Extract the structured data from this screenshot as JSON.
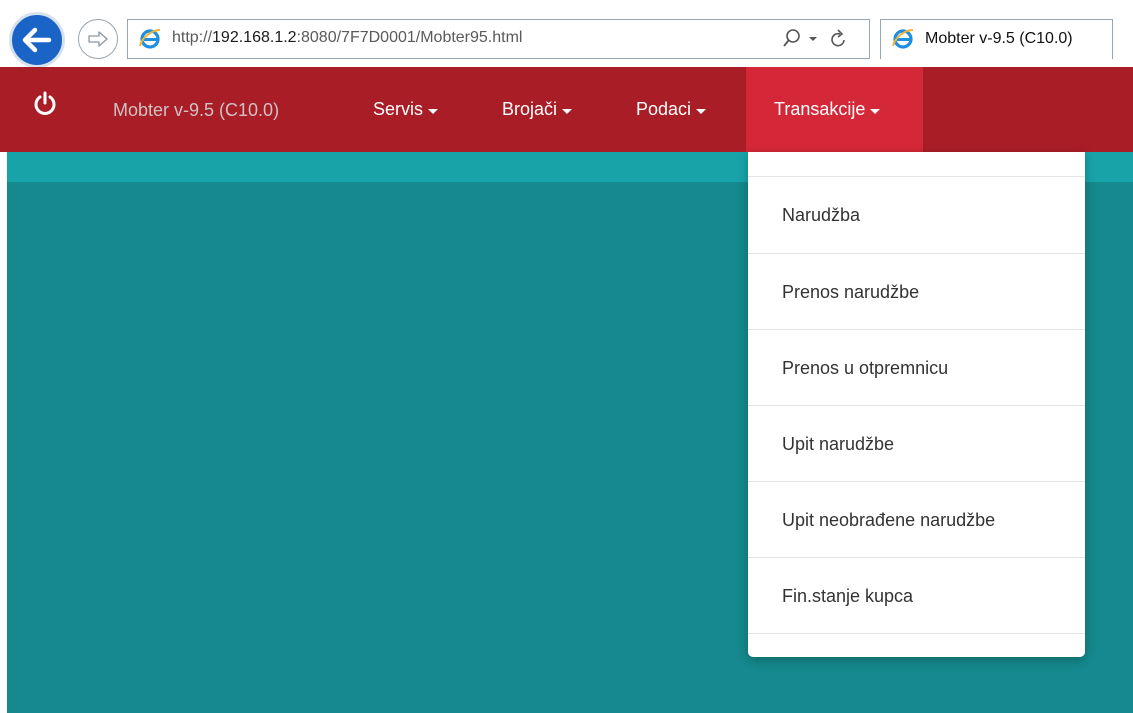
{
  "browser": {
    "url_prefix": "http://",
    "url_host": "192.168.1.2",
    "url_rest": ":8080/7F7D0001/Mobter95.html",
    "tab_title": "Mobter v-9.5 (C10.0)"
  },
  "navbar": {
    "brand": "Mobter v-9.5 (C10.0)",
    "items": [
      {
        "label": "Servis"
      },
      {
        "label": "Brojači"
      },
      {
        "label": "Podaci"
      },
      {
        "label": "Transakcije"
      }
    ],
    "active_item": "Transakcije"
  },
  "dropdown": {
    "items": [
      {
        "label": "Narudžba"
      },
      {
        "label": "Prenos narudžbe"
      },
      {
        "label": "Prenos u otpremnicu"
      },
      {
        "label": "Upit narudžbe"
      },
      {
        "label": "Upit neobrađene narudžbe"
      },
      {
        "label": "Fin.stanje kupca"
      }
    ]
  },
  "colors": {
    "navbar": "#a91d27",
    "navbar_active": "#d42737",
    "content": "#15898d",
    "content_band": "#18a3a9"
  },
  "icons": {
    "back": "back-arrow-icon",
    "forward": "forward-arrow-icon",
    "browser_logo": "internet-explorer-icon",
    "search": "search-icon",
    "refresh": "refresh-icon",
    "power": "power-icon"
  }
}
